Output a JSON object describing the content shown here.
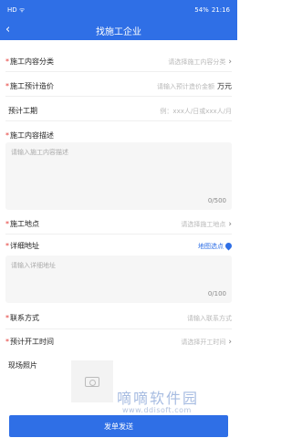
{
  "status_bar": {
    "left": "HD ᯤ",
    "battery": "54%",
    "time": "21:16"
  },
  "header": {
    "title": "找施工企业",
    "back_icon": "back-arrow-icon"
  },
  "form": {
    "content_category": {
      "label": "施工内容分类",
      "placeholder": "请选择施工内容分类"
    },
    "budget": {
      "label": "施工预计造价",
      "placeholder": "请输入预计造价金额",
      "unit": "万元"
    },
    "duration": {
      "label": "预计工期",
      "placeholder": "例：xxx人/日或xxx人/月"
    },
    "description": {
      "label": "施工内容描述",
      "placeholder": "请输入施工内容描述",
      "counter": "0/500"
    },
    "location": {
      "label": "施工地点",
      "placeholder": "请选择施工地点"
    },
    "address": {
      "label": "详细地址",
      "map_link": "地图选点",
      "placeholder": "请输入详细地址",
      "counter": "0/100"
    },
    "contact": {
      "label": "联系方式",
      "placeholder": "请输入联系方式"
    },
    "start_time": {
      "label": "预计开工时间",
      "placeholder": "请选择开工时间"
    },
    "photos": {
      "label": "现场照片"
    }
  },
  "watermark": {
    "main": "嘀嘀软件园",
    "sub": "www.ddisoft.com"
  },
  "submit_label": "发单发送"
}
